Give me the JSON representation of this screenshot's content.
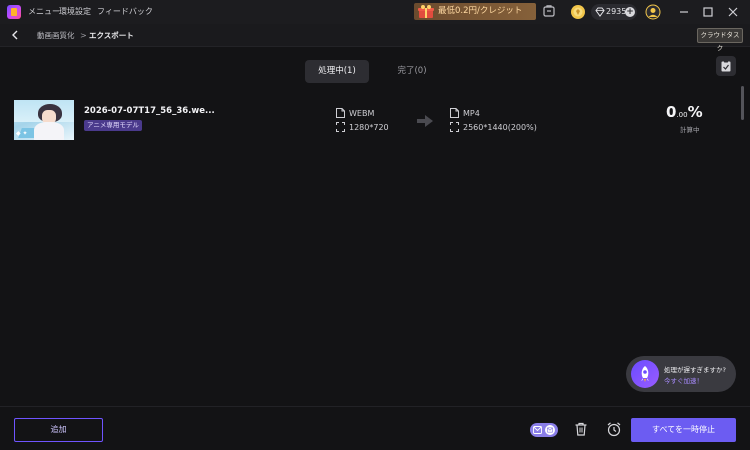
{
  "titlebar": {
    "menu": [
      "メニュー",
      "環境設定",
      "フィードバック"
    ],
    "promo": "最低0.2円/クレジット",
    "credits": "2935"
  },
  "breadcrumb": {
    "parent": "動画画質化",
    "separator": ">",
    "current": "エクスポート",
    "cloud_task": "クラウドタスク"
  },
  "tabs": {
    "processing": "処理中(1)",
    "completed": "完了(0)"
  },
  "task": {
    "filename": "2026-07-07T17_56_36.we...",
    "model": "アニメ専用モデル",
    "source": {
      "format": "WEBM",
      "resolution": "1280*720"
    },
    "target": {
      "format": "MP4",
      "resolution": "2560*1440(200%)"
    },
    "progress_int": "0",
    "progress_dec": ".00",
    "progress_unit": "%",
    "status": "計算中"
  },
  "speed_tip": {
    "question": "処理が遅すぎますか?",
    "action": "今すぐ加速！"
  },
  "bottom": {
    "add": "追加",
    "pause_all": "すべてを一時停止"
  },
  "colors": {
    "accent": "#6c5cf2",
    "background": "#131315",
    "promo_text": "#ffd9a1"
  }
}
